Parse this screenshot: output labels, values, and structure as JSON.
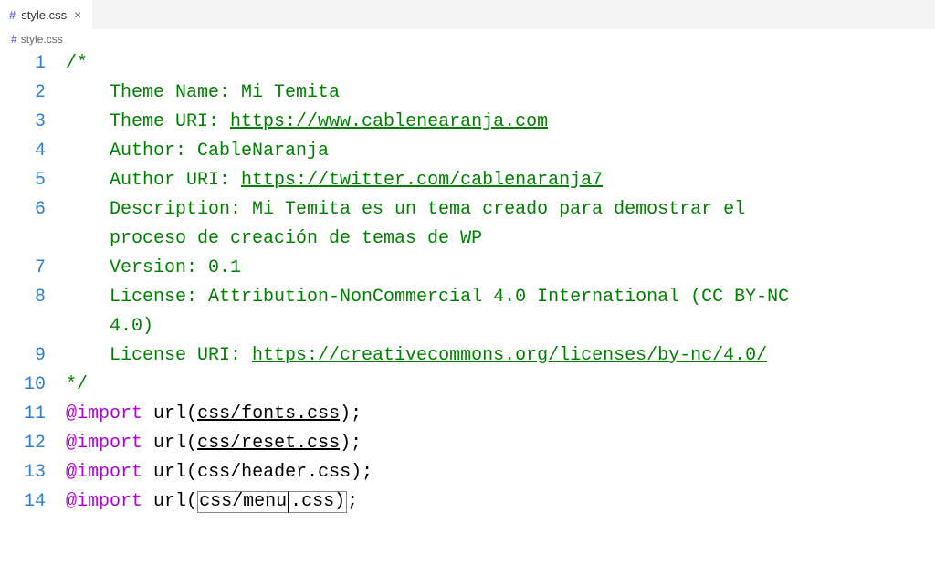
{
  "tab": {
    "icon": "#",
    "label": "style.css",
    "close": "×"
  },
  "breadcrumb": {
    "icon": "#",
    "label": "style.css"
  },
  "lines": {
    "n1": "1",
    "n2": "2",
    "n3": "3",
    "n4": "4",
    "n5": "5",
    "n6": "6",
    "n6b": "",
    "n7": "7",
    "n8": "8",
    "n8b": "",
    "n9": "9",
    "n10": "10",
    "n11": "11",
    "n12": "12",
    "n13": "13",
    "n14": "14"
  },
  "l1": {
    "a": "/*"
  },
  "l2": {
    "a": "Theme Name: Mi Temita"
  },
  "l3": {
    "a": "Theme URI: ",
    "b": "https://www.cablenearanja.com"
  },
  "l4": {
    "a": "Author: CableNaranja"
  },
  "l5": {
    "a": "Author URI: ",
    "b": "https://twitter.com/cablenaranja7"
  },
  "l6": {
    "a": "Description: Mi Temita es un tema creado para demostrar el ",
    "b": "proceso de creación de temas de WP"
  },
  "l7": {
    "a": "Version: 0.1"
  },
  "l8": {
    "a": "License: Attribution-NonCommercial 4.0 International (CC BY-NC ",
    "b": "4.0)"
  },
  "l9": {
    "a": "License URI: ",
    "b": "https://creativecommons.org/licenses/by-nc/4.0/"
  },
  "l10": {
    "a": "*/"
  },
  "l11": {
    "kw": "@import",
    "sp": " ",
    "fn": "url",
    "op": "(",
    "s": "css/fonts.css",
    "cp": ")",
    "sc": ";"
  },
  "l12": {
    "kw": "@import",
    "sp": " ",
    "fn": "url",
    "op": "(",
    "s": "css/reset.css",
    "cp": ")",
    "sc": ";"
  },
  "l13": {
    "kw": "@import",
    "sp": " ",
    "fn": "url",
    "op": "(",
    "s": "css/header.css",
    "cp": ")",
    "sc": ";"
  },
  "l14": {
    "kw": "@import",
    "sp": " ",
    "fn": "url",
    "op": "(",
    "s1": "css/menu",
    "s2": ".css",
    "cp": ")",
    "sc": ";"
  }
}
